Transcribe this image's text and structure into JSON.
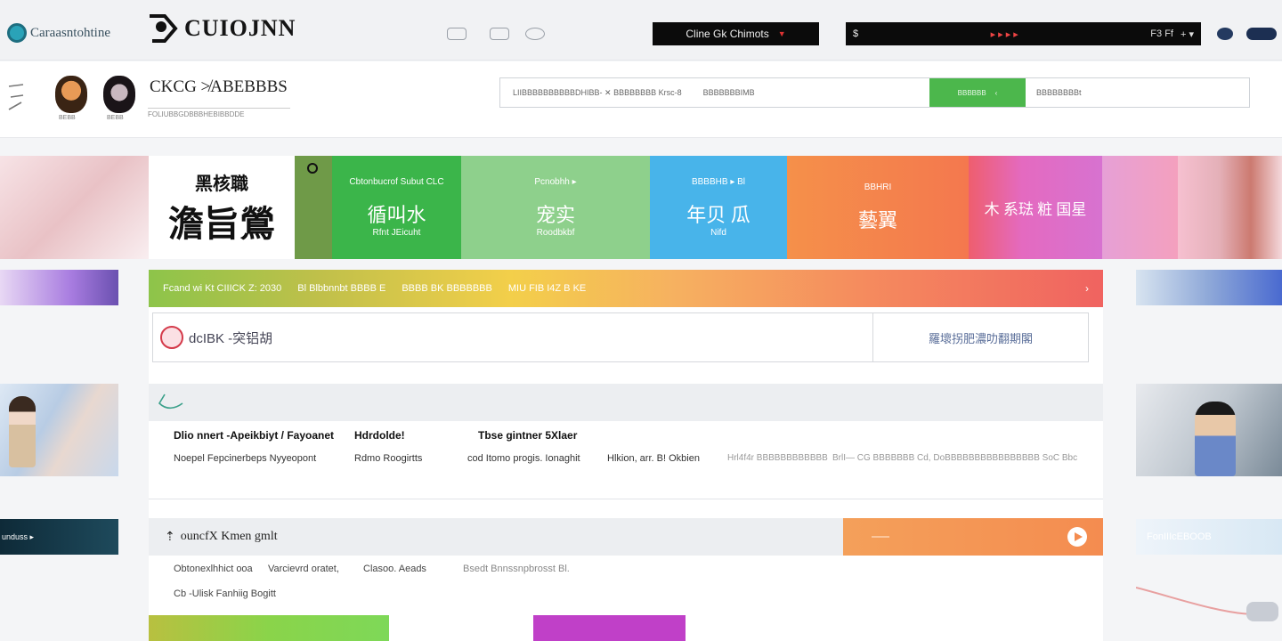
{
  "topbar": {
    "logo_left": "Caraasntohtine",
    "logo_main": "CUIOJNN",
    "button_dark": "Cline Gk Chimots",
    "dark_bar_left": "$",
    "dark_bar_right": "F3 Ff",
    "dark_bar_right2": "+ ▾"
  },
  "header": {
    "brand_title": "CKCG ≯ABEBBBS",
    "brand_sub": "FOLIUBBGDBBBHEBIBBDDE",
    "avatar1_caption": "BEBB",
    "avatar2_caption": "BEBB",
    "search_placeholder": "LIIBBBBBBBBBBDHIBB- ✕ BBBBBBBB Krsc-8",
    "search_placeholder2": "BBBBBBBIMB",
    "search_button": "BBBBBB",
    "search_right": "BBBBBBBBt"
  },
  "banner": {
    "white_t1": "黑核職",
    "white_t2": "澹旨鶯",
    "green_small": "Cbtonbucrof Subut CLC",
    "green_big": "循叫水",
    "green_tiny": "Rfnt JEicuht",
    "lightgreen_small": "Pcnobhh ▸",
    "lightgreen_big": "宠实",
    "lightgreen_tiny": "Roodbkbf",
    "blue_small": "BBBBHB ▸ Bl",
    "blue_big": "年贝 瓜",
    "blue_tiny": "Nifd",
    "orange_small": "BBHRI",
    "orange_big": "藝翼",
    "pink_big": "木 系琺 粧 国星"
  },
  "promo_bar": {
    "seg1": "Fcand wi Kt  CIIICK Z: 2030",
    "seg2": "Bl Blbbnnbt BBBB E",
    "seg3": "BBBB BK BBBBBBB",
    "seg4": "MIU FIB I4Z B KE"
  },
  "notice": {
    "left_text": "dcIBK -突铝胡",
    "right_text": "羅壞拐肥濃叻翻期閣"
  },
  "section1": {
    "headers": [
      "Dlio nnert -Apeikbiyt / Fayoanet",
      "Hdrdolde!",
      "Tbse gintner 5Xlaer"
    ],
    "row": [
      "Noepel Fepcinerbeps Nyyeopont",
      "Rdmo Roogirtts",
      "cod Itomo progis. Ionaghit",
      "Hlkion, arr. B! Okbien"
    ],
    "row_grey1": "Hrl4f4r BBBBBBBBBBBB",
    "row_grey2": "BrlI— CG BBBBBBB Cd, DoBBBBBBBBBBBBBBBB SoC Bbc"
  },
  "section2": {
    "title": "ouncfX Kmen gmlt",
    "row1": [
      "Obtonexlhhict ooa",
      "Varcievrd oratet,",
      "Clasoo. Aeads",
      "Bsedt Bnnssnpbrosst Bl."
    ],
    "row2": "Cb -Ulisk Fanhiig Bogitt"
  },
  "side": {
    "left_dark_text": "unduss ▸",
    "right_bottom_text": "FonIIIcEBOOB"
  },
  "colors": {
    "green": "#4cb74c",
    "blue": "#48b4ea",
    "orange": "#f4854a",
    "pink": "#ef6f8c"
  }
}
